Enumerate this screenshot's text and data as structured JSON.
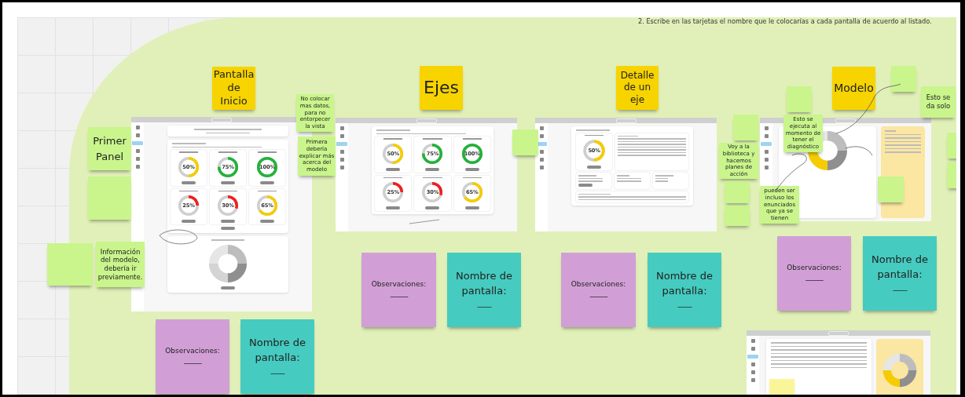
{
  "instruction": "2. Escribe en las tarjetas el nombre que le colocarías a cada pantalla de acuerdo al listado.",
  "titles": [
    {
      "text": "Pantalla de Inicio"
    },
    {
      "text": "Ejes"
    },
    {
      "text": "Detalle de un eje"
    },
    {
      "text": "Modelo"
    }
  ],
  "comments": [
    {
      "kind": "large",
      "color": "#c9f58c",
      "text": "Primer Panel"
    },
    {
      "kind": "small",
      "color": "#c9f58c"
    },
    {
      "kind": "small",
      "color": "#c9f58c",
      "text": "No colocar mas datos, para no entorpecer la vista"
    },
    {
      "kind": "small",
      "color": "#c9f58c",
      "text": "Primera debería explicar más acerca del modelo"
    },
    {
      "kind": "small",
      "color": "#c9f58c"
    },
    {
      "kind": "medium",
      "color": "#c9f58c",
      "text": "Información del modelo, debería ir previamente."
    },
    {
      "kind": "small",
      "color": "#c9f58c"
    },
    {
      "kind": "small",
      "color": "#c9f58c"
    },
    {
      "kind": "small",
      "color": "#c9f58c",
      "text": "Esto se ejecuta al momento de tener el diagnóstico"
    },
    {
      "kind": "small",
      "color": "#c9f58c"
    },
    {
      "kind": "small",
      "color": "#c9f58c",
      "text": "Voy a la biblioteca y hacemos planes de acción"
    },
    {
      "kind": "small",
      "color": "#c9f58c"
    },
    {
      "kind": "small",
      "color": "#c9f58c"
    },
    {
      "kind": "small",
      "color": "#c9f58c",
      "text": "pueden ser incluso los enunciados que ya se tienen"
    },
    {
      "kind": "small",
      "color": "#c9f58c"
    },
    {
      "kind": "small",
      "color": "#c9f58c"
    },
    {
      "kind": "medium",
      "color": "#c9f58c",
      "text": "Esto se da solo"
    },
    {
      "kind": "small",
      "color": "#c9f58c"
    },
    {
      "kind": "small",
      "color": "#c9f58c"
    },
    {
      "kind": "small",
      "color": "#fbf59a"
    }
  ],
  "answer_cards": [
    {
      "kind": "observations",
      "label": "Observaciones:",
      "blank": "----------"
    },
    {
      "kind": "name",
      "label": "Nombre de pantalla:",
      "blank": "--------"
    },
    {
      "kind": "observations",
      "label": "Observaciones:",
      "blank": "----------"
    },
    {
      "kind": "name",
      "label": "Nombre de pantalla:",
      "blank": "--------"
    },
    {
      "kind": "observations",
      "label": "Observaciones:",
      "blank": "----------"
    },
    {
      "kind": "name",
      "label": "Nombre de pantalla:",
      "blank": "--------"
    },
    {
      "kind": "observations",
      "label": "Observaciones:",
      "blank": "----------"
    },
    {
      "kind": "name",
      "label": "Nombre de pantalla:",
      "blank": "--------"
    }
  ],
  "screens": [
    {
      "kind": "home",
      "gauges": [
        {
          "percent": "50%",
          "level": 0.5,
          "color": "#f5cc00"
        },
        {
          "percent": "75%",
          "level": 0.75,
          "color": "#22b33a"
        },
        {
          "percent": "100%",
          "level": 1,
          "color": "#22b33a"
        },
        {
          "percent": "25%",
          "level": 0.25,
          "color": "#f01e1e"
        },
        {
          "percent": "30%",
          "level": 0.3,
          "color": "#f01e1e"
        },
        {
          "percent": "65%",
          "level": 0.65,
          "color": "#f5cc00"
        }
      ]
    },
    {
      "kind": "axes",
      "gauges": [
        {
          "percent": "50%",
          "level": 0.5,
          "color": "#f5cc00"
        },
        {
          "percent": "75%",
          "level": 0.75,
          "color": "#22b33a"
        },
        {
          "percent": "100%",
          "level": 1,
          "color": "#22b33a"
        },
        {
          "percent": "25%",
          "level": 0.25,
          "color": "#f01e1e"
        },
        {
          "percent": "30%",
          "level": 0.3,
          "color": "#f01e1e"
        },
        {
          "percent": "65%",
          "level": 0.65,
          "color": "#f5cc00"
        }
      ]
    },
    {
      "kind": "detail",
      "gauges": [
        {
          "percent": "50%",
          "level": 0.5,
          "color": "#f5cc00"
        }
      ]
    },
    {
      "kind": "model"
    },
    {
      "kind": "table"
    }
  ]
}
